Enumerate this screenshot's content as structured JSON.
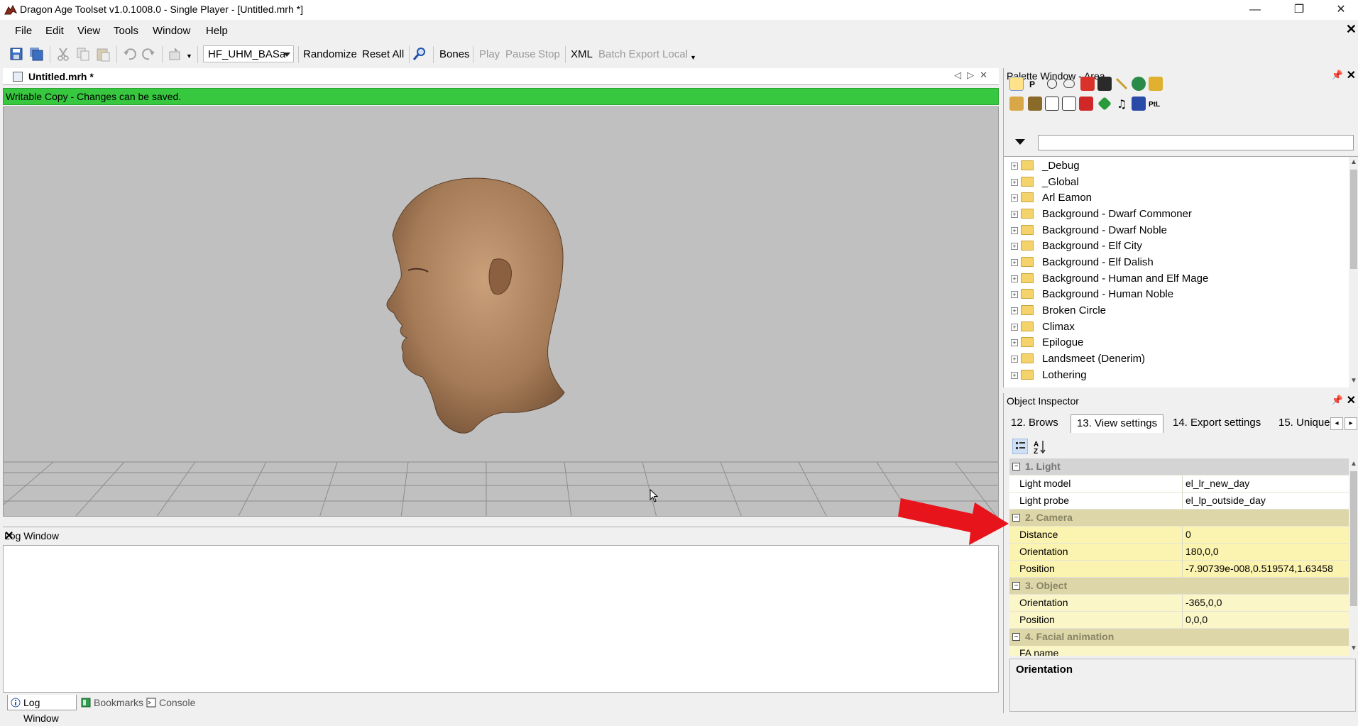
{
  "window": {
    "title": "Dragon Age Toolset v1.0.1008.0 - Single Player - [Untitled.mrh *]",
    "controls": {
      "minimize": "—",
      "maximize": "❐",
      "close": "✕"
    },
    "mdi_close": "✕"
  },
  "menu": [
    "File",
    "Edit",
    "View",
    "Tools",
    "Window",
    "Help"
  ],
  "toolbar": {
    "combo_value": "HF_UHM_BASa",
    "randomize": "Randomize",
    "reset_all": "Reset All",
    "bones": "Bones",
    "play": "Play",
    "pause": "Pause",
    "stop": "Stop",
    "xml": "XML",
    "batch_export": "Batch Export Local"
  },
  "document": {
    "tab_label": "Untitled.mrh *",
    "status": "Writable Copy - Changes can be saved.",
    "status_color": "#37c83f"
  },
  "log": {
    "title": "Log Window",
    "tabs": [
      {
        "label": "Log Window",
        "icon": "info-icon"
      },
      {
        "label": "Bookmarks",
        "icon": "bookmark-icon"
      },
      {
        "label": "Console",
        "icon": "console-icon"
      }
    ]
  },
  "palette": {
    "title": "Palette Window - Area",
    "search_value": "",
    "tree": [
      "_Debug",
      "_Global",
      "Arl Eamon",
      "Background - Dwarf Commoner",
      "Background - Dwarf Noble",
      "Background - Elf City",
      "Background - Elf Dalish",
      "Background - Human and Elf Mage",
      "Background - Human Noble",
      "Broken Circle",
      "Climax",
      "Epilogue",
      "Landsmeet (Denerim)",
      "Lothering"
    ]
  },
  "inspector": {
    "title": "Object Inspector",
    "tabs": [
      "12. Brows",
      "13. View settings",
      "14. Export settings",
      "15. Unique"
    ],
    "active_tab": "13. View settings",
    "categories": [
      {
        "label": "1. Light",
        "rows": [
          {
            "key": "Light model",
            "value": "el_lr_new_day"
          },
          {
            "key": "Light probe",
            "value": "el_lp_outside_day"
          }
        ]
      },
      {
        "label": "2. Camera",
        "rows": [
          {
            "key": "Distance",
            "value": "0"
          },
          {
            "key": "Orientation",
            "value": "180,0,0"
          },
          {
            "key": "Position",
            "value": "-7.90739e-008,0.519574,1.63458"
          }
        ]
      },
      {
        "label": "3. Object",
        "rows": [
          {
            "key": "Orientation",
            "value": "-365,0,0"
          },
          {
            "key": "Position",
            "value": "0,0,0"
          }
        ]
      },
      {
        "label": "4. Facial animation",
        "rows": [
          {
            "key": "FA name",
            "value": ""
          }
        ]
      }
    ],
    "description_title": "Orientation"
  },
  "annotation": {
    "arrow_color": "#e8141c"
  }
}
